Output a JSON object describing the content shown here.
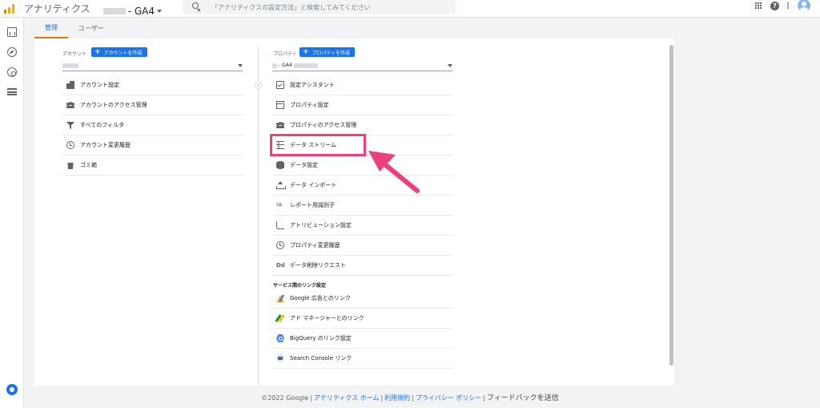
{
  "topbar": {
    "app_title": "アナリティクス",
    "account_name": "- GA4",
    "search_placeholder": "「アナリティクスの設定方法」と検索してみてください"
  },
  "tabs": [
    {
      "label": "管理",
      "active": true
    },
    {
      "label": "ユーザー",
      "active": false
    }
  ],
  "account": {
    "label": "アカウント",
    "create_label": "アカウントを作成",
    "menu": [
      {
        "label": "アカウント設定",
        "icon": "building-icon"
      },
      {
        "label": "アカウントのアクセス管理",
        "icon": "people-icon"
      },
      {
        "label": "すべてのフィルタ",
        "icon": "filter-icon"
      },
      {
        "label": "アカウント変更履歴",
        "icon": "history-icon"
      },
      {
        "label": "ゴミ箱",
        "icon": "trash-icon"
      }
    ]
  },
  "property": {
    "label": "プロパティ",
    "create_label": "プロパティを作成",
    "selected_suffix": "- GA4",
    "menu": [
      {
        "label": "設定アシスタント",
        "icon": "checklist-icon"
      },
      {
        "label": "プロパティ設定",
        "icon": "property-icon"
      },
      {
        "label": "プロパティのアクセス管理",
        "icon": "people-icon"
      },
      {
        "label": "データ ストリーム",
        "icon": "data-stream-icon"
      },
      {
        "label": "データ設定",
        "icon": "database-icon"
      },
      {
        "label": "データ インポート",
        "icon": "upload-icon"
      },
      {
        "label": "レポート用識別子",
        "icon": "identifier-icon"
      },
      {
        "label": "アトリビューション設定",
        "icon": "attribution-icon"
      },
      {
        "label": "プロパティ変更履歴",
        "icon": "history-icon"
      },
      {
        "label": "データ削除リクエスト",
        "icon": "data-deletion-icon",
        "glyph": "Dd"
      }
    ],
    "link_section_title": "サービス間のリンク設定",
    "links": [
      {
        "label": "Google 広告とのリンク",
        "icon": "google-ads-icon"
      },
      {
        "label": "アド マネージャーとのリンク",
        "icon": "ad-manager-icon"
      },
      {
        "label": "BigQuery のリンク設定",
        "icon": "bigquery-icon"
      },
      {
        "label": "Search Console リンク",
        "icon": "search-console-icon"
      }
    ]
  },
  "footer": {
    "copyright": "©2022 Google",
    "links": [
      "アナリティクス ホーム",
      "利用規約",
      "プライバシー ポリシー"
    ],
    "feedback": "フィードバックを送信"
  },
  "colors": {
    "accent": "#1a73e8",
    "highlight": "#ec407a",
    "tab_underline": "#e37400"
  }
}
